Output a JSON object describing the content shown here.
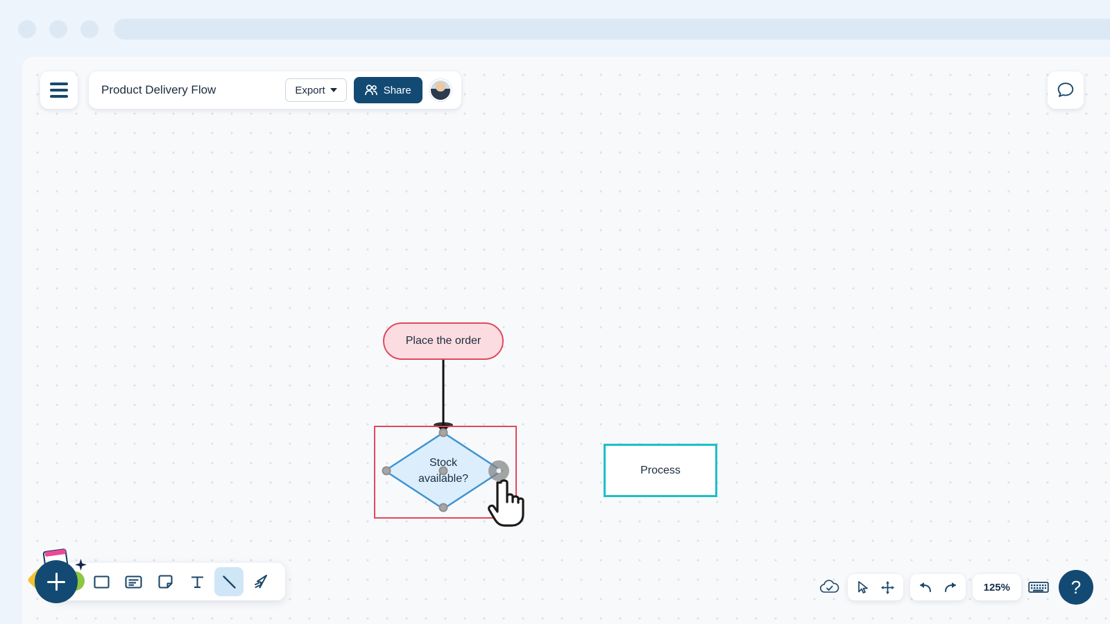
{
  "browser": {
    "dots": [
      "window-dot-1",
      "window-dot-2",
      "window-dot-3"
    ],
    "url_placeholder": ""
  },
  "topbar": {
    "menu_icon": "hamburger-icon",
    "doc_title": "Product Delivery Flow",
    "export_label": "Export",
    "export_caret_icon": "chevron-down-icon",
    "share_label": "Share",
    "share_icon": "users-icon",
    "avatar_icon": "user-avatar",
    "comment_icon": "comment-bubble-icon",
    "accent_color": "#134a73"
  },
  "canvas": {
    "zoom_label": "125%",
    "background_color": "#f8f9fb",
    "grid_dot_color": "#dfe1e7"
  },
  "diagram": {
    "shapes": [
      {
        "id": "place-the-order",
        "type": "terminator",
        "label": "Place the order",
        "fill": "#fbdde1",
        "stroke": "#e0485e"
      },
      {
        "id": "stock-available",
        "type": "decision",
        "label_line1": "Stock",
        "label_line2": "available?",
        "fill": "#dceefb",
        "stroke": "#3f93d1",
        "selected": true,
        "selection_stroke": "#e0485e"
      },
      {
        "id": "process",
        "type": "process",
        "label": "Process",
        "fill": "#ffffff",
        "stroke": "#1ac0c6"
      }
    ],
    "connectors": [
      {
        "id": "order-to-decision",
        "from": "place-the-order",
        "to": "stock-available",
        "stroke": "#111111",
        "arrow": "filled-triangle"
      }
    ],
    "handles": [
      "handle-top",
      "handle-left",
      "handle-center",
      "handle-right",
      "handle-bottom"
    ],
    "hovered_handle": "handle-right",
    "cursor_icon": "pointing-hand-cursor"
  },
  "toolbar": {
    "add_button_icon": "plus-icon",
    "tools": [
      {
        "id": "rectangle",
        "icon": "rectangle-icon",
        "active": false
      },
      {
        "id": "card",
        "icon": "card-icon",
        "active": false
      },
      {
        "id": "sticky-note",
        "icon": "sticky-note-icon",
        "active": false
      },
      {
        "id": "text",
        "icon": "text-icon",
        "active": false
      },
      {
        "id": "line",
        "icon": "line-icon",
        "active": true
      },
      {
        "id": "pen",
        "icon": "pen-icon",
        "active": false
      }
    ],
    "active_tool_highlight": "#cfe6f7"
  },
  "statusbar": {
    "cloud_saved_icon": "cloud-check-icon",
    "select_icon": "cursor-arrow-icon",
    "pan_icon": "move-arrows-icon",
    "undo_icon": "undo-icon",
    "redo_icon": "redo-icon",
    "zoom_level": "125%",
    "keyboard_icon": "keyboard-icon",
    "help_label": "?"
  }
}
